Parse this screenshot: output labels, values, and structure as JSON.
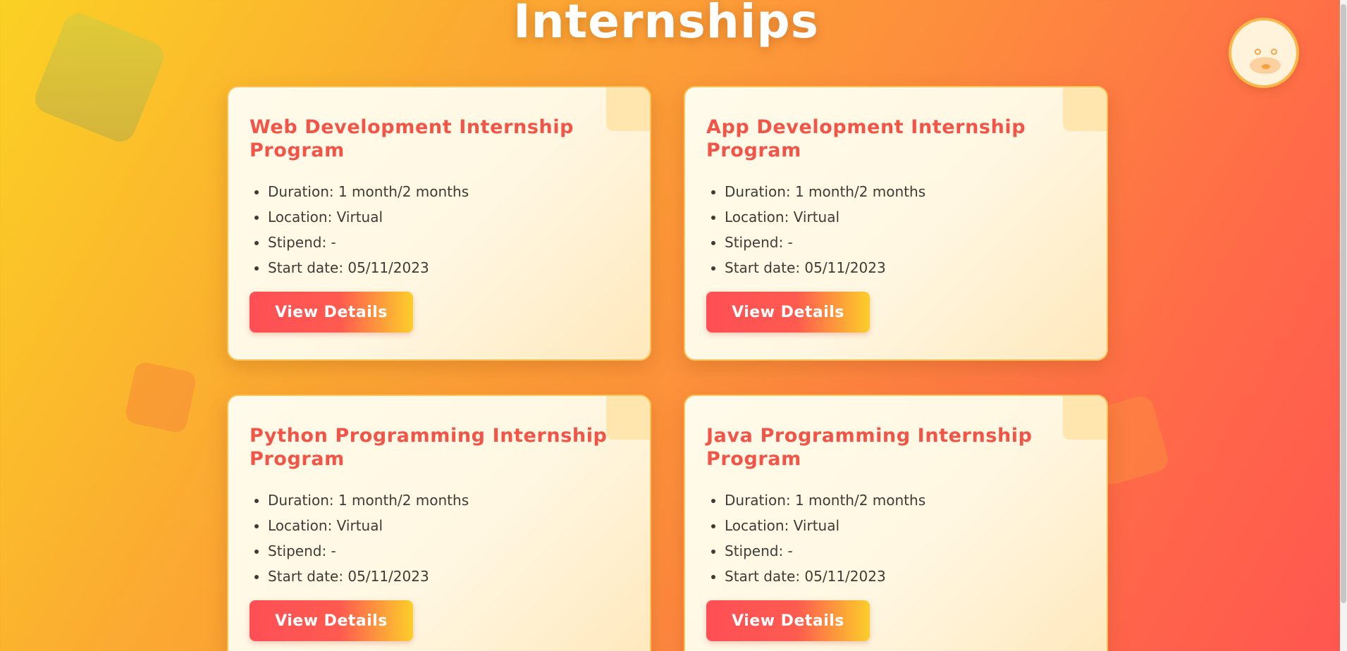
{
  "page": {
    "title": "Internships"
  },
  "colors": {
    "accent": "#f25447",
    "button_start": "#fe4f55",
    "button_end": "#fbce2a",
    "background_start": "#fbd124",
    "background_end": "#ff5650"
  },
  "avatar": {
    "icon": "pig-face-icon"
  },
  "internships": [
    {
      "title": "Web Development Internship Program",
      "duration": "Duration: 1 month/2 months",
      "location": "Location: Virtual",
      "stipend": "Stipend: -",
      "start_date": "Start date: 05/11/2023",
      "button_label": "View Details"
    },
    {
      "title": "App Development Internship Program",
      "duration": "Duration: 1 month/2 months",
      "location": "Location: Virtual",
      "stipend": "Stipend: -",
      "start_date": "Start date: 05/11/2023",
      "button_label": "View Details"
    },
    {
      "title": "Python Programming Internship Program",
      "duration": "Duration: 1 month/2 months",
      "location": "Location: Virtual",
      "stipend": "Stipend: -",
      "start_date": "Start date: 05/11/2023",
      "button_label": "View Details"
    },
    {
      "title": "Java Programming Internship Program",
      "duration": "Duration: 1 month/2 months",
      "location": "Location: Virtual",
      "stipend": "Stipend: -",
      "start_date": "Start date: 05/11/2023",
      "button_label": "View Details"
    }
  ]
}
